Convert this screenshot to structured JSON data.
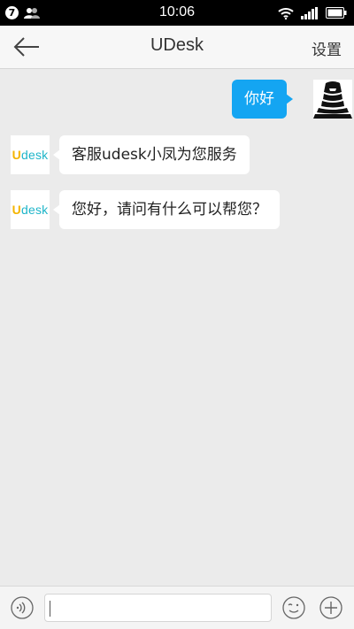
{
  "status_bar": {
    "notification_count": "7",
    "time": "10:06",
    "icons": [
      "contacts-icon",
      "wifi-icon",
      "signal-icon",
      "battery-icon"
    ]
  },
  "nav": {
    "title": "UDesk",
    "settings_label": "设置",
    "back_icon": "back-arrow-icon"
  },
  "messages": [
    {
      "direction": "outgoing",
      "text": "你好",
      "avatar": "user-avatar"
    },
    {
      "direction": "incoming",
      "text": "客服udesk小凤为您服务",
      "avatar": "udesk-logo"
    },
    {
      "direction": "incoming",
      "text": "您好，请问有什么可以帮您？",
      "avatar": "udesk-logo"
    }
  ],
  "agent_logo_text": {
    "u": "U",
    "rest": "desk"
  },
  "input_bar": {
    "value": "",
    "icons": [
      "voice-icon",
      "emoji-icon",
      "plus-icon"
    ]
  },
  "colors": {
    "outgoing_bubble": "#14a5f2",
    "background": "#ebebeb",
    "brand_teal": "#1fb5c9"
  }
}
